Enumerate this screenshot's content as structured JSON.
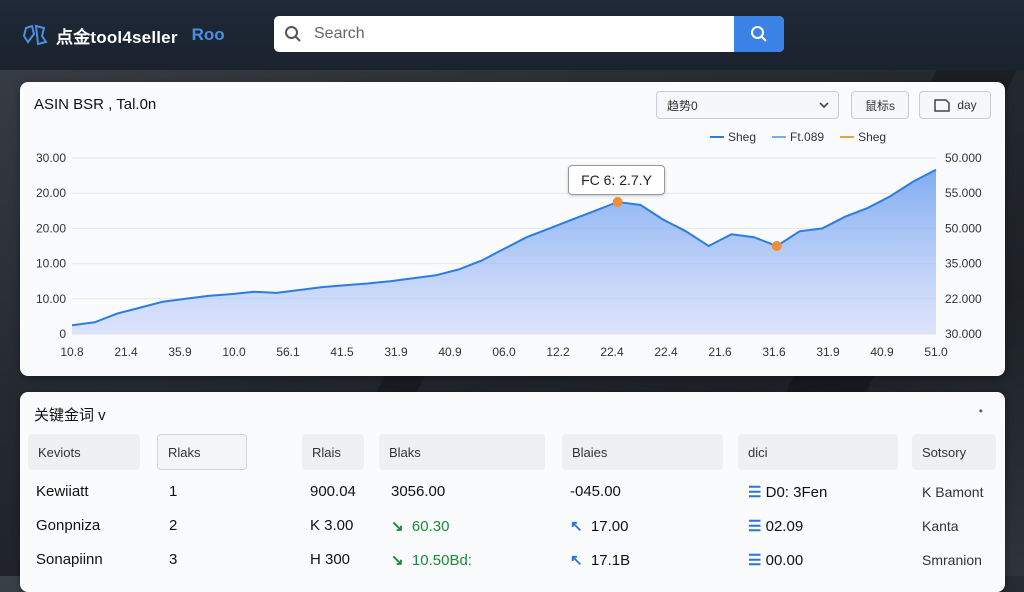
{
  "app": {
    "logo_text": "点金tool4seller",
    "logo_accent": "Roo"
  },
  "search": {
    "placeholder": "Search"
  },
  "chart_panel": {
    "title": "ASIN BSR , Tal.0n",
    "select_label": "趋势0",
    "btn1_label": "鼠标s",
    "btn2_label": "day",
    "legend": [
      {
        "label": "Sheg",
        "color": "#2b7de0"
      },
      {
        "label": "Ft.089",
        "color": "#7aaef0"
      },
      {
        "label": "Sheg",
        "color": "#f0a040"
      }
    ],
    "tooltip": "FC  6: 2.7.Y"
  },
  "chart_data": {
    "type": "area",
    "y_left_ticks": [
      "30.00",
      "20.00",
      "20.00",
      "10.00",
      "10.00",
      "0"
    ],
    "y_right_ticks": [
      "50.000",
      "55.000",
      "50.000",
      "35.000",
      "22.000",
      "30.000"
    ],
    "x_ticks": [
      "10.8",
      "21.4",
      "35.9",
      "10.0",
      "56.1",
      "41.5",
      "31.9",
      "40.9",
      "06.0",
      "12.2",
      "22.4",
      "22.4",
      "21.6",
      "31.6",
      "31.9",
      "40.9",
      "51.0"
    ],
    "ylim": [
      0,
      30
    ],
    "series": [
      {
        "values": [
          1.5,
          2.0,
          3.5,
          4.5,
          5.5,
          6.0,
          6.5,
          6.8,
          7.2,
          7.0,
          7.5,
          8.0,
          8.3,
          8.6,
          9.0,
          9.5,
          10.0,
          11.0,
          12.5,
          14.5,
          16.5,
          18.0,
          19.5,
          21.0,
          22.5,
          22.0,
          19.5,
          17.5,
          15.0,
          17.0,
          16.5,
          15.0,
          17.5,
          18.0,
          20.0,
          21.5,
          23.5,
          26.0,
          28.0
        ]
      }
    ],
    "markers": [
      {
        "x_index": 24,
        "color": "#f08c3a"
      },
      {
        "x_index": 31,
        "color": "#f08c3a"
      }
    ],
    "grid": true
  },
  "table": {
    "title": "关键金词 v",
    "menu": "•",
    "headers": [
      "Keviots",
      "Rlaks",
      "Rlais",
      "Blaks",
      "Blaies",
      "dici",
      "Sotsory"
    ],
    "rows": [
      {
        "kw": "Kewiiatt",
        "rank": "1",
        "c3": "900.04",
        "c4": "3056.00",
        "c5": "-045.00",
        "c6": "D0: 3Fen",
        "c7": "K  Bamont"
      },
      {
        "kw": "Gonpniza",
        "rank": "2",
        "c3": "K  3.00",
        "c4": "60.30",
        "c5": "17.00",
        "c6": "02.09",
        "c7": "Kanta"
      },
      {
        "kw": "Sonapiinn",
        "rank": "3",
        "c3": "H  300",
        "c4": "10.50Bd:",
        "c5": "17.1B",
        "c6": "00.00",
        "c7": "Smranion"
      }
    ]
  }
}
